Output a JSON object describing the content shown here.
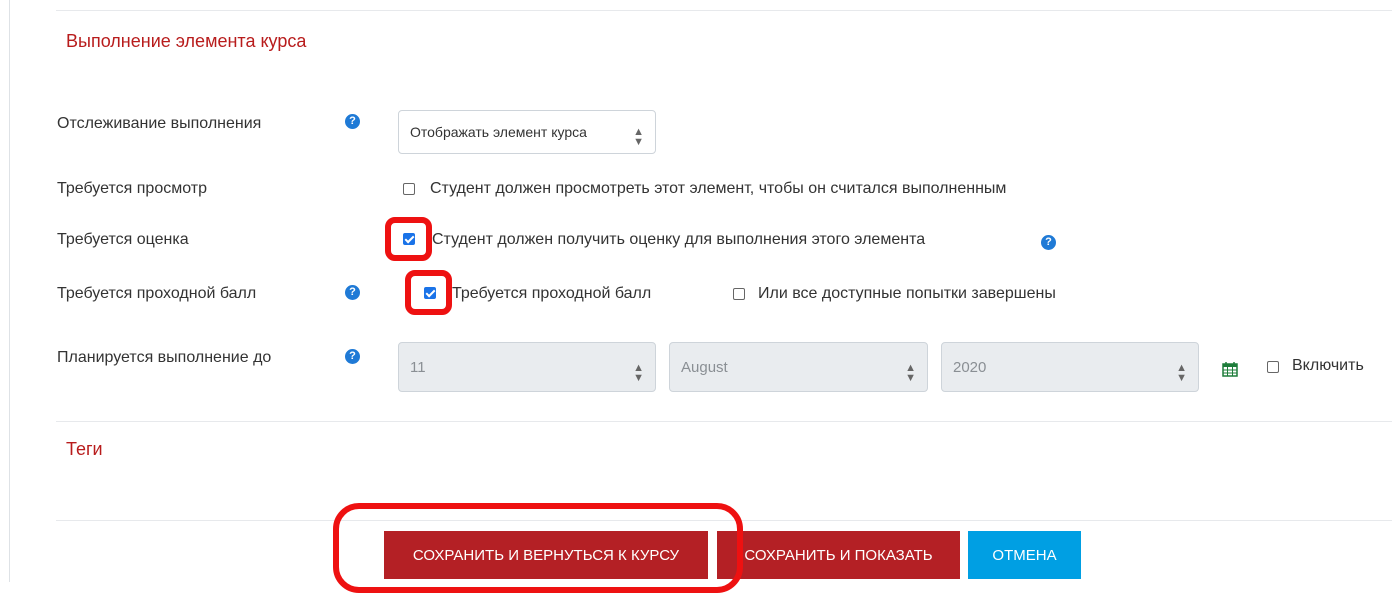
{
  "completion_section": {
    "title": "Выполнение элемента курса"
  },
  "tracking": {
    "label": "Отслеживание выполнения",
    "select_value": "Отображать элемент курса",
    "help_icon": "question-circle-icon"
  },
  "view": {
    "label": "Требуется просмотр",
    "checkbox_label": "Студент должен просмотреть этот элемент, чтобы он считался выполненным",
    "checked": false
  },
  "grade": {
    "label": "Требуется оценка",
    "checkbox_label": "Студент должен получить оценку для выполнения этого элемента",
    "checked": true
  },
  "passgrade": {
    "label": "Требуется проходной балл",
    "checkbox_label": "Требуется проходной балл",
    "checked": true,
    "alt_checkbox_label": "Или все доступные попытки завершены",
    "alt_checked": false
  },
  "expected": {
    "label": "Планируется выполнение до",
    "day": "11",
    "month": "August",
    "year": "2020",
    "calendar_icon": "calendar-icon",
    "enable_label": "Включить",
    "enabled": false
  },
  "tags_section": {
    "title": "Теги"
  },
  "buttons": {
    "save_return": "СОХРАНИТЬ И ВЕРНУТЬСЯ К КУРСУ",
    "save_display": "СОХРАНИТЬ И ПОКАЗАТЬ",
    "cancel": "ОТМЕНА"
  },
  "colors": {
    "section_title": "#b81c1c",
    "primary_button": "#b42025",
    "cancel_button": "#009fe3",
    "help_icon": "#1f7ad6",
    "annotation_ring": "#ee1111"
  }
}
